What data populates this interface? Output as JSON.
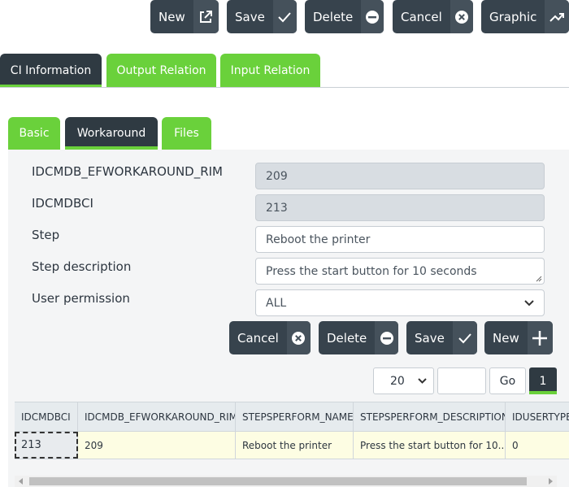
{
  "toolbar": {
    "new": "New",
    "save": "Save",
    "delete": "Delete",
    "cancel": "Cancel",
    "graphic": "Graphic"
  },
  "main_tabs": [
    "CI Information",
    "Output Relation",
    "Input Relation"
  ],
  "main_tab_active": "CI Information",
  "sub_tabs": [
    "Basic",
    "Workaround",
    "Files"
  ],
  "sub_tab_active": "Workaround",
  "form": {
    "fields": [
      {
        "label": "IDCMDB_EFWORKAROUND_RIM",
        "value": "209",
        "readonly": true
      },
      {
        "label": "IDCMDBCI",
        "value": "213",
        "readonly": true
      },
      {
        "label": "Step",
        "value": "Reboot the printer",
        "readonly": false
      },
      {
        "label": "Step description",
        "value": "Press the start button for 10 seconds",
        "readonly": false
      },
      {
        "label": "User permission",
        "value": "ALL",
        "readonly": false
      }
    ]
  },
  "form_buttons": {
    "cancel": "Cancel",
    "delete": "Delete",
    "save": "Save",
    "new": "New"
  },
  "pager": {
    "page_size": "20",
    "go": "Go",
    "page": "1"
  },
  "grid": {
    "columns": [
      "IDCMDBCI",
      "IDCMDB_EFWORKAROUND_RIM",
      "STEPSPERFORM_NAME",
      "STEPSPERFORM_DESCRIPTION",
      "IDUSERTYPE"
    ],
    "rows": [
      [
        "213",
        "209",
        "Reboot the printer",
        "Press the start button for 10...",
        "0"
      ]
    ]
  },
  "colors": {
    "dark": "#37434d",
    "green": "#6ad13b",
    "readonly_field": "#d8dde2",
    "selected_row": "#fdfde3"
  }
}
